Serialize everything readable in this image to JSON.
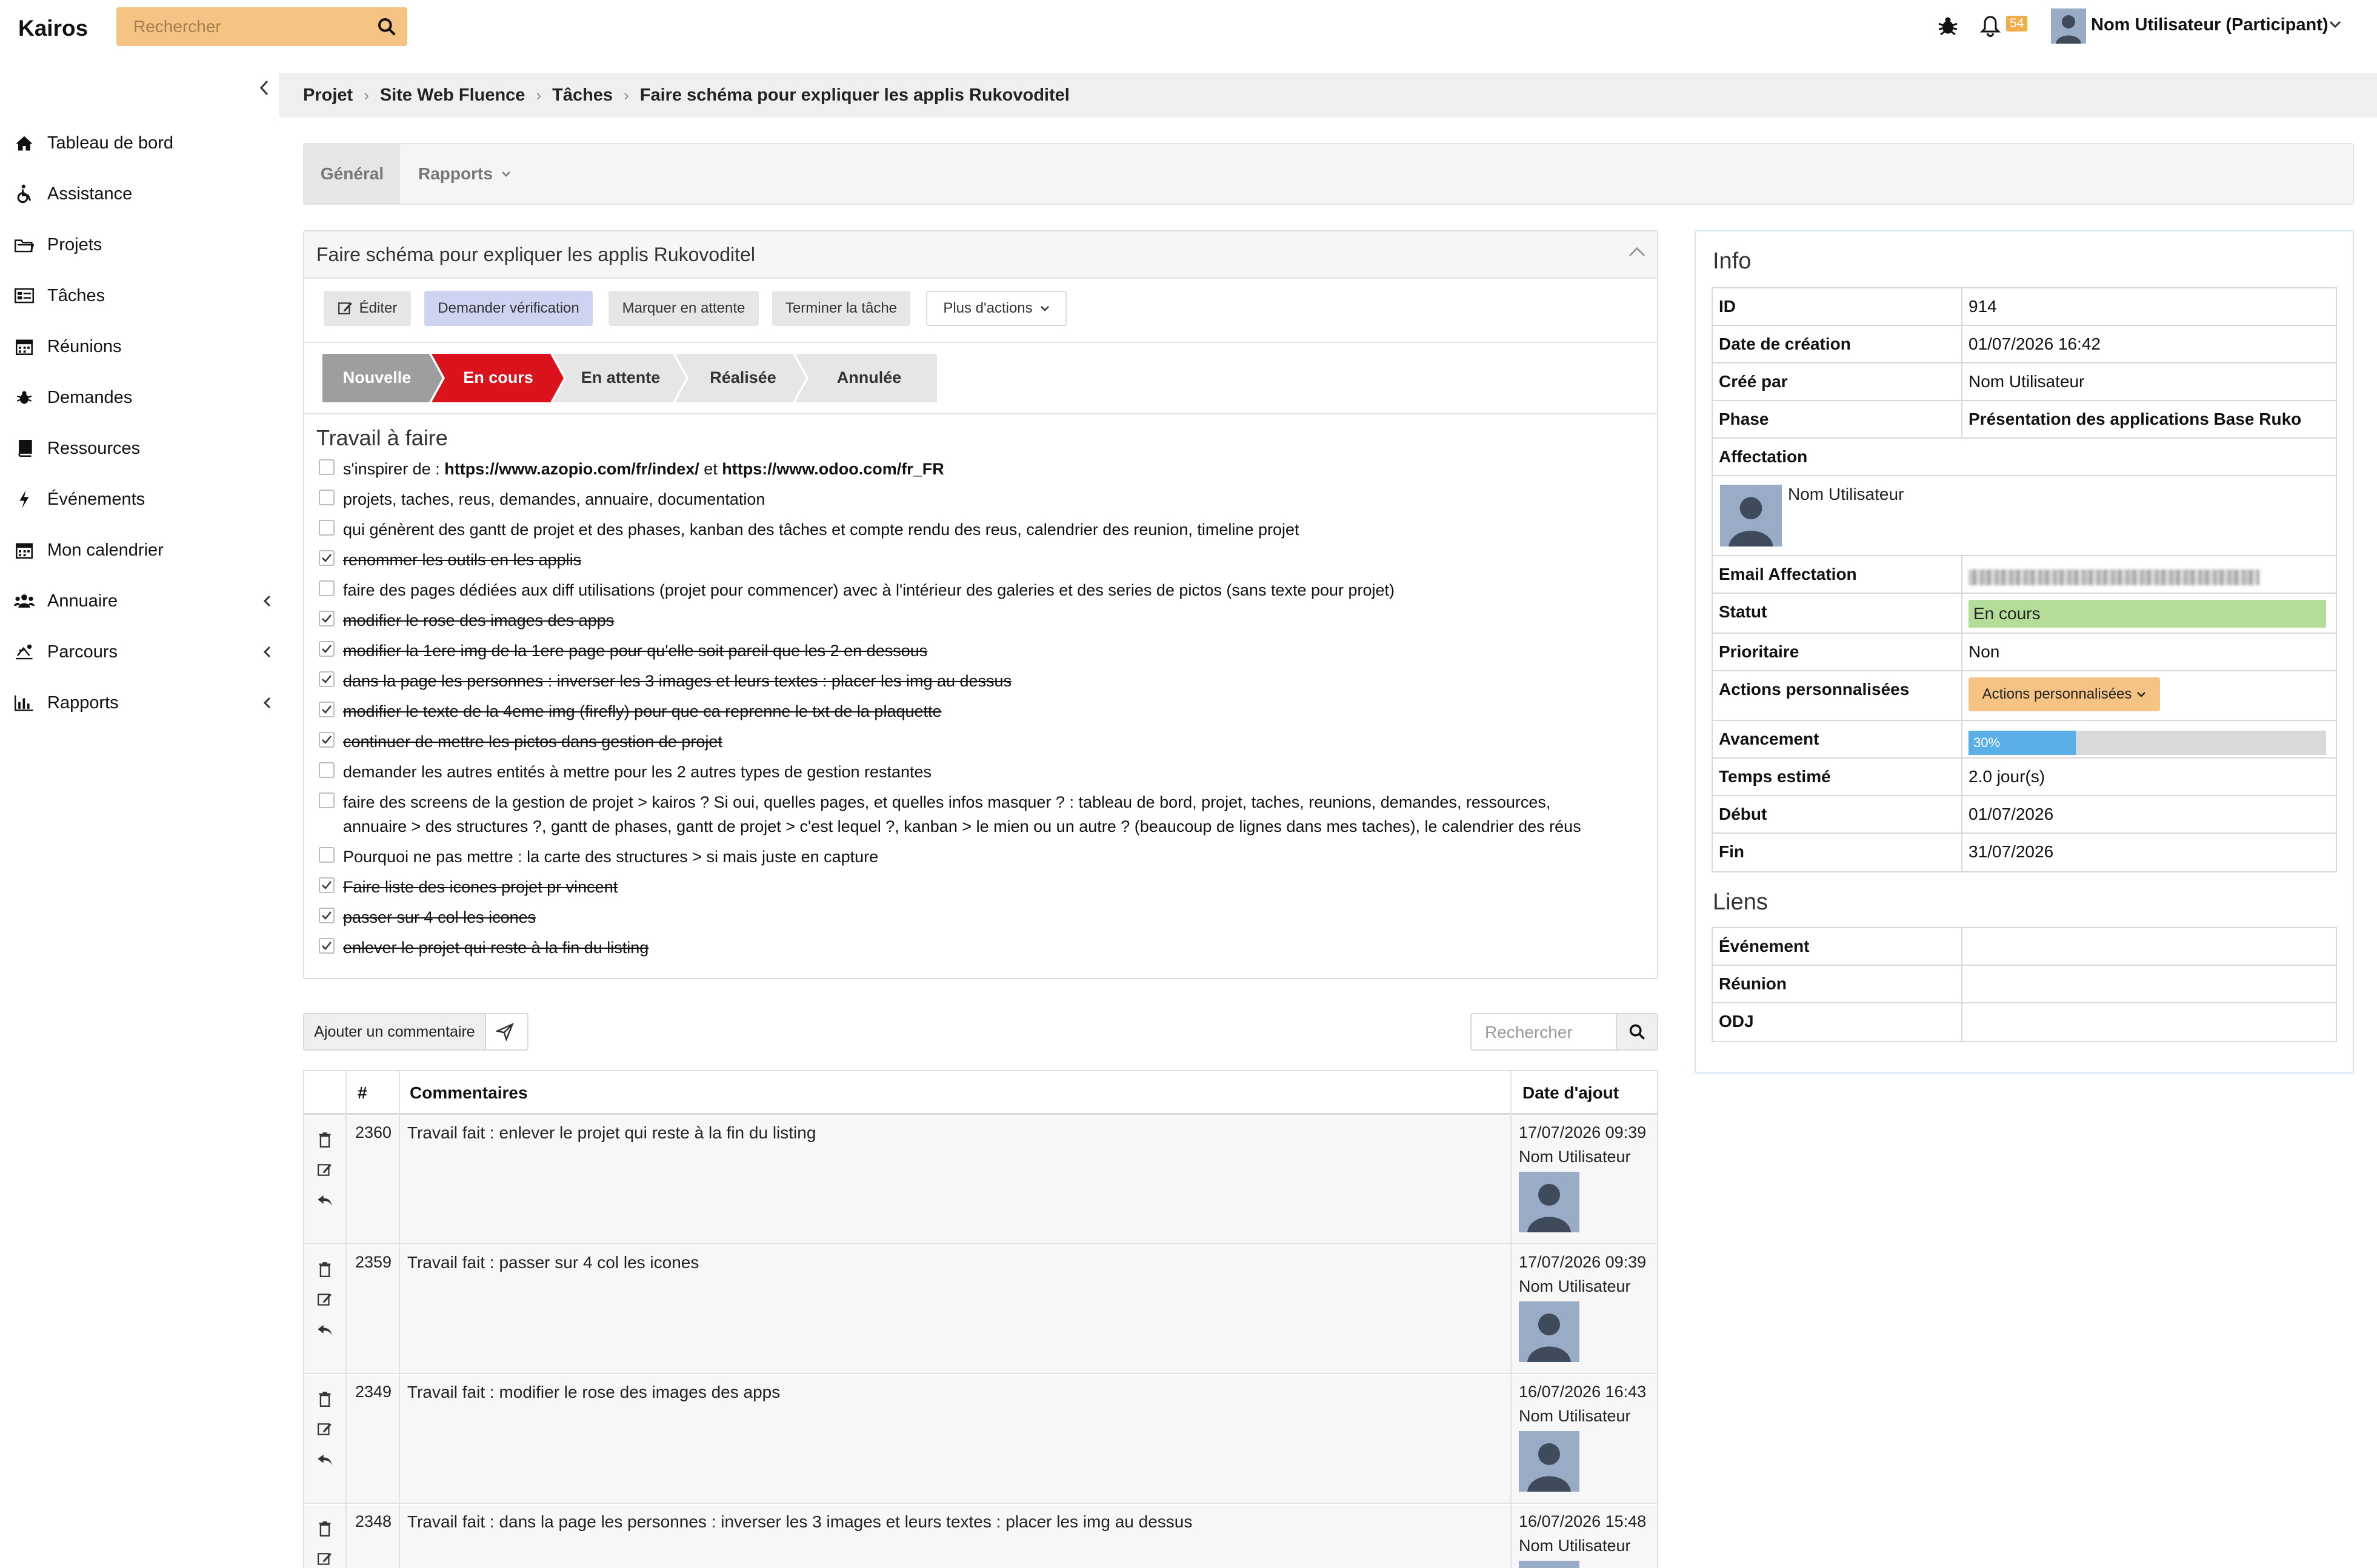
{
  "app": {
    "title": "Kairos"
  },
  "top": {
    "search_placeholder": "Rechercher",
    "notifications": "54",
    "user": "Nom Utilisateur (Participant)"
  },
  "sidebar": {
    "items": [
      {
        "label": "Tableau de bord",
        "icon": "home-icon"
      },
      {
        "label": "Assistance",
        "icon": "wheelchair-icon"
      },
      {
        "label": "Projets",
        "icon": "projects-icon"
      },
      {
        "label": "Tâches",
        "icon": "tasks-icon"
      },
      {
        "label": "Réunions",
        "icon": "calendar-icon"
      },
      {
        "label": "Demandes",
        "icon": "bug-icon"
      },
      {
        "label": "Ressources",
        "icon": "book-icon"
      },
      {
        "label": "Événements",
        "icon": "bolt-icon"
      },
      {
        "label": "Mon calendrier",
        "icon": "calendar-icon"
      },
      {
        "label": "Annuaire",
        "icon": "users-icon"
      },
      {
        "label": "Parcours",
        "icon": "route-icon"
      },
      {
        "label": "Rapports",
        "icon": "bar-chart-icon"
      }
    ]
  },
  "breadcrumb": [
    "Projet",
    "Site Web Fluence",
    "Tâches",
    "Faire schéma pour expliquer les applis Rukovoditel"
  ],
  "tabs": {
    "general": "Général",
    "rapports": "Rapports"
  },
  "task": {
    "title": "Faire schéma pour expliquer les applis Rukovoditel",
    "buttons": {
      "edit": "Éditer",
      "request_verification": "Demander vérification",
      "mark_waiting": "Marquer en attente",
      "finish": "Terminer la tâche",
      "more": "Plus d'actions"
    },
    "phases": [
      "Nouvelle",
      "En cours",
      "En attente",
      "Réalisée",
      "Annulée"
    ],
    "phase_colors": {
      "done": "#9e9e9e",
      "current": "#d9121b",
      "todo": "#e6e6e6"
    },
    "todo_title": "Travail à faire",
    "todo": [
      {
        "pre": "s'inspirer de : ",
        "link1": "https://www.azopio.com/fr/index/",
        "mid": " et ",
        "link2": "https://www.odoo.com/fr_FR",
        "done": false
      },
      {
        "text": "projets, taches, reus, demandes, annuaire, documentation",
        "done": false
      },
      {
        "text": "qui génèrent des gantt de projet et des phases, kanban des tâches et compte rendu des reus, calendrier des reunion, timeline projet",
        "done": false
      },
      {
        "text": "renommer les outils en les applis",
        "done": true
      },
      {
        "text": "faire des pages dédiées aux diff utilisations (projet pour commencer) avec à l'intérieur des galeries et des series de pictos (sans texte pour projet)",
        "done": false
      },
      {
        "text": "modifier le rose des images des apps",
        "done": true
      },
      {
        "text": "modifier la 1ere img de la 1ere page pour qu'elle soit pareil que les 2 en dessous",
        "done": true
      },
      {
        "text": "dans la page les personnes : inverser les 3 images et leurs textes : placer les img au dessus",
        "done": true
      },
      {
        "text": "modifier le texte de la 4eme img (firefly) pour que ca reprenne le txt de la plaquette",
        "done": true
      },
      {
        "text": "continuer de mettre les pictos dans gestion de projet",
        "done": true
      },
      {
        "text": "demander les autres entités à mettre pour les 2 autres types de gestion restantes",
        "done": false
      },
      {
        "text": "faire des screens de la gestion de projet > kairos ? Si oui, quelles pages, et quelles infos masquer ? : tableau de bord, projet, taches, reunions, demandes, ressources,",
        "text2": "annuaire > des structures ?, gantt de phases, gantt de projet > c'est lequel ?, kanban > le mien ou un autre ? (beaucoup de lignes dans mes taches), le calendrier des réus",
        "done": false
      },
      {
        "text": "Pourquoi ne pas mettre : la carte des structures > si mais juste en capture",
        "done": false
      },
      {
        "text": "Faire liste des icones projet pr vincent",
        "done": true
      },
      {
        "text": "passer sur 4 col les icones",
        "done": true
      },
      {
        "text": "enlever le projet qui reste à la fin du listing",
        "done": true
      }
    ]
  },
  "comments": {
    "add_label": "Ajouter un commentaire",
    "search_placeholder": "Rechercher",
    "headers": {
      "num": "#",
      "comments": "Commentaires",
      "date": "Date d'ajout"
    },
    "rows": [
      {
        "id": "2360",
        "text": "Travail fait : enlever le projet qui reste à la fin du listing",
        "date": "17/07/2026 09:39",
        "author": "Nom Utilisateur"
      },
      {
        "id": "2359",
        "text": "Travail fait : passer sur 4 col les icones",
        "date": "17/07/2026 09:39",
        "author": "Nom Utilisateur"
      },
      {
        "id": "2349",
        "text": "Travail fait : modifier le rose des images des apps",
        "date": "16/07/2026 16:43",
        "author": "Nom Utilisateur"
      },
      {
        "id": "2348",
        "text": "Travail fait : dans la page les personnes : inverser les 3 images et leurs textes : placer les img au dessus",
        "date": "16/07/2026 15:48",
        "author": "Nom Utilisateur"
      }
    ]
  },
  "info": {
    "title": "Info",
    "id_label": "ID",
    "id": "914",
    "created_label": "Date de création",
    "created": "01/07/2026 16:42",
    "creator_label": "Créé par",
    "creator": "Nom Utilisateur",
    "phase_label": "Phase",
    "phase": "Présentation des applications Base Ruko",
    "affectation_label": "Affectation",
    "affectation": "Nom Utilisateur",
    "email_label": "Email Affectation",
    "status_label": "Statut",
    "status": "En cours",
    "priority_label": "Prioritaire",
    "priority": "Non",
    "custom_actions_label": "Actions personnalisées",
    "custom_actions_button": "Actions personnalisées",
    "progress_label": "Avancement",
    "progress": "30%",
    "progress_value": 0.3,
    "estimate_label": "Temps estimé",
    "estimate": "2.0 jour(s)",
    "start_label": "Début",
    "start": "01/07/2026",
    "end_label": "Fin",
    "end": "31/07/2026"
  },
  "links": {
    "title": "Liens",
    "rows": [
      "Événement",
      "Réunion",
      "ODJ"
    ]
  }
}
